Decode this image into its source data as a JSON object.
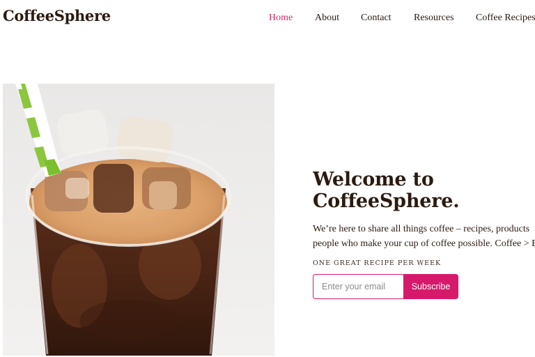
{
  "site": {
    "logo": "CoffeeSphere"
  },
  "nav": {
    "items": [
      {
        "label": "Home",
        "active": true
      },
      {
        "label": "About",
        "active": false
      },
      {
        "label": "Contact",
        "active": false
      },
      {
        "label": "Resources",
        "active": false
      },
      {
        "label": "Coffee Recipes",
        "active": false
      }
    ]
  },
  "hero": {
    "image_alt": "Iced coffee in a glass with a green and white striped straw",
    "title_line1": "Welcome to",
    "title_line2": "CoffeeSphere.",
    "desc_line1": "We’re here to share all things coffee – recipes, products",
    "desc_line2": "people who make your cup of coffee possible. Coffee > E",
    "eyebrow": "ONE GREAT RECIPE PER WEEK",
    "email_placeholder": "Enter your email",
    "subscribe_label": "Subscribe"
  },
  "colors": {
    "accent": "#d6196a",
    "nav_active": "#cf2e6e",
    "text_dark": "#2b1a10"
  }
}
